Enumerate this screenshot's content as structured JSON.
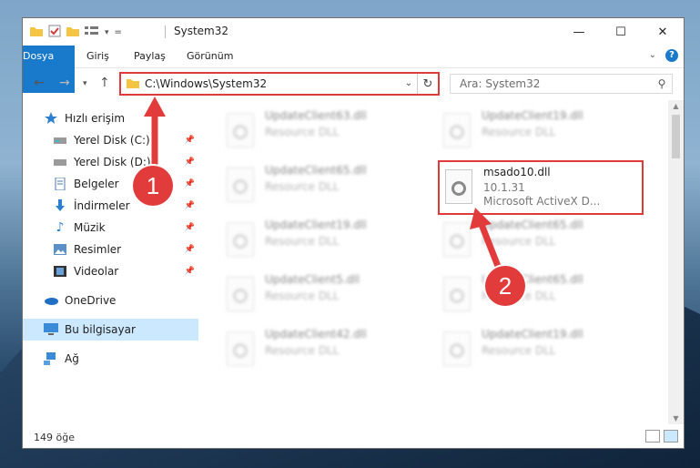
{
  "window": {
    "title": "System32",
    "controls": {
      "minimize": "—",
      "maximize": "☐",
      "close": "✕"
    }
  },
  "ribbon": {
    "tabs": [
      {
        "label": "Dosya"
      },
      {
        "label": "Giriş"
      },
      {
        "label": "Paylaş"
      },
      {
        "label": "Görünüm"
      }
    ],
    "help": "?"
  },
  "navigation": {
    "address": "C:\\Windows\\System32",
    "search_placeholder": "Ara: System32"
  },
  "sidebar": {
    "items": [
      {
        "label": "Hızlı erişim",
        "icon": "star-icon",
        "pinned": false
      },
      {
        "label": "Yerel Disk (C:)",
        "icon": "drive-icon",
        "pinned": true
      },
      {
        "label": "Yerel Disk (D:)",
        "icon": "drive-icon",
        "pinned": true
      },
      {
        "label": "Belgeler",
        "icon": "document-icon",
        "pinned": true
      },
      {
        "label": "İndirmeler",
        "icon": "download-icon",
        "pinned": true
      },
      {
        "label": "Müzik",
        "icon": "music-icon",
        "pinned": true
      },
      {
        "label": "Resimler",
        "icon": "image-icon",
        "pinned": true
      },
      {
        "label": "Videolar",
        "icon": "video-icon",
        "pinned": true
      },
      {
        "label": "OneDrive",
        "icon": "cloud-icon",
        "pinned": false
      },
      {
        "label": "Bu bilgisayar",
        "icon": "computer-icon",
        "pinned": false
      },
      {
        "label": "Ağ",
        "icon": "network-icon",
        "pinned": false
      }
    ]
  },
  "files": {
    "left": [
      {
        "name": "UpdateClient63.dll",
        "type": "Resource DLL"
      },
      {
        "name": "UpdateClient65.dll",
        "type": "Resource DLL"
      },
      {
        "name": "UpdateClient19.dll",
        "type": "Resource DLL"
      },
      {
        "name": "UpdateClient5.dll",
        "type": "Resource DLL"
      },
      {
        "name": "UpdateClient42.dll",
        "type": "Resource DLL"
      }
    ],
    "right": [
      {
        "name": "UpdateClient19.dll",
        "type": "Resource DLL"
      },
      {
        "name": "msado10.dll",
        "version": "10.1.31",
        "type": "Microsoft ActiveX D..."
      },
      {
        "name": "UpdateClient65.dll",
        "type": "Resource DLL"
      },
      {
        "name": "UpdateClient65.dll",
        "type": "Resource DLL"
      },
      {
        "name": "UpdateClient19.dll",
        "type": "Resource DLL"
      }
    ]
  },
  "status": {
    "item_count": "149 öğe"
  },
  "annotations": {
    "callout_1": "1",
    "callout_2": "2"
  },
  "colors": {
    "accent": "#1979ca",
    "highlight": "#e03a3a",
    "selected": "#cce8ff"
  }
}
